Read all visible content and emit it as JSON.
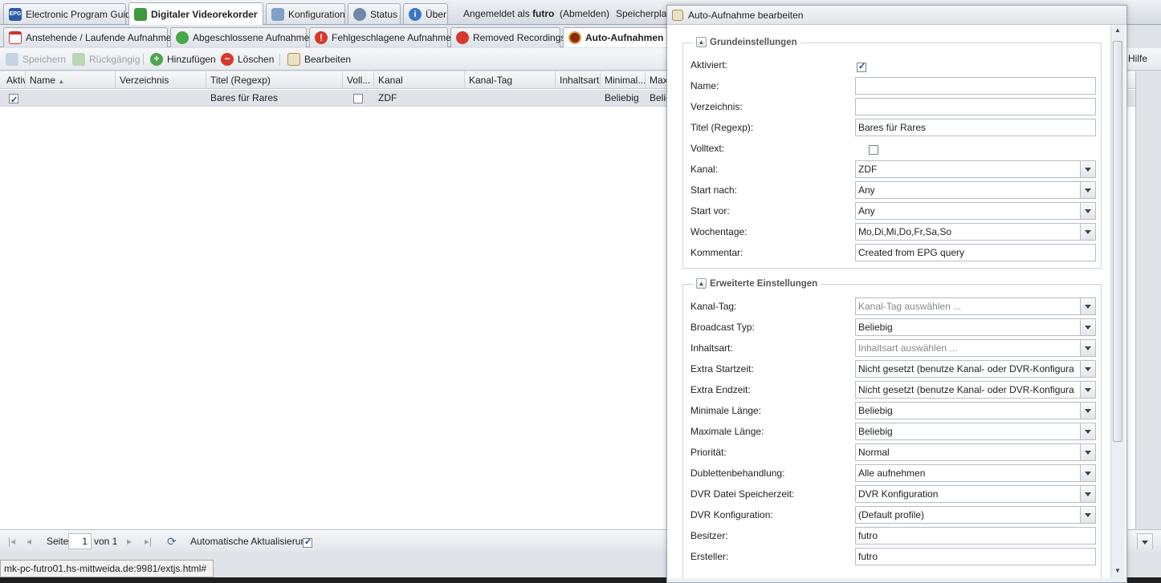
{
  "top_tabs": [
    {
      "label": "Electronic Program Guide",
      "icon": "epg-icon"
    },
    {
      "label": "Digitaler Videorekorder",
      "icon": "download-icon"
    },
    {
      "label": "Konfiguration",
      "icon": "wrench-icon"
    },
    {
      "label": "Status",
      "icon": "eye-icon"
    },
    {
      "label": "Über",
      "icon": "info-icon"
    }
  ],
  "top_info": {
    "logged_in_prefix": "Angemeldet als",
    "user": "futro",
    "logout": "(Abmelden)",
    "storage": "Speicherplatz",
    "help": "Hilfe"
  },
  "sub_tabs": [
    {
      "label": "Anstehende / Laufende Aufnahmen",
      "icon": "calendar-icon"
    },
    {
      "label": "Abgeschlossene Aufnahmen",
      "icon": "check-circle-icon"
    },
    {
      "label": "Fehlgeschlagene Aufnahmen",
      "icon": "error-icon"
    },
    {
      "label": "Removed Recordings",
      "icon": "remove-icon"
    },
    {
      "label": "Auto-Aufnahmen",
      "icon": "record-icon"
    }
  ],
  "toolbar": {
    "save": "Speichern",
    "undo": "Rückgängig",
    "add": "Hinzufügen",
    "delete": "Löschen",
    "edit": "Bearbeiten"
  },
  "grid": {
    "columns": [
      "Aktiv",
      "Name",
      "Verzeichnis",
      "Titel (Regexp)",
      "Voll...",
      "Kanal",
      "Kanal-Tag",
      "Inhaltsart",
      "Minimal...",
      "Max"
    ],
    "row": {
      "enabled": true,
      "name": "",
      "directory": "",
      "title": "Bares für Rares",
      "fulltext": false,
      "channel": "ZDF",
      "channel_tag": "",
      "content_type": "",
      "min": "Beliebig",
      "max": "Belie"
    }
  },
  "paging": {
    "page_label": "Seite",
    "page": "1",
    "of": "von 1",
    "auto_refresh": "Automatische Aktualisierung",
    "auto_refresh_checked": true
  },
  "status_url": "mk-pc-futro01.hs-mittweida.de:9981/extjs.html#",
  "dialog": {
    "title": "Auto-Aufnahme bearbeiten",
    "basic_legend": "Grundeinstellungen",
    "basic": {
      "enabled_label": "Aktiviert:",
      "enabled": true,
      "name_label": "Name:",
      "name": "",
      "directory_label": "Verzeichnis:",
      "directory": "",
      "title_label": "Titel (Regexp):",
      "title": "Bares für Rares",
      "fulltext_label": "Volltext:",
      "fulltext": false,
      "channel_label": "Kanal:",
      "channel": "ZDF",
      "start_after_label": "Start nach:",
      "start_after": "Any",
      "start_before_label": "Start vor:",
      "start_before": "Any",
      "weekdays_label": "Wochentage:",
      "weekdays": "Mo,Di,Mi,Do,Fr,Sa,So",
      "comment_label": "Kommentar:",
      "comment": "Created from EPG query"
    },
    "advanced_legend": "Erweiterte Einstellungen",
    "advanced": {
      "channel_tag_label": "Kanal-Tag:",
      "channel_tag_placeholder": "Kanal-Tag auswählen ...",
      "broadcast_type_label": "Broadcast Typ:",
      "broadcast_type": "Beliebig",
      "content_type_label": "Inhaltsart:",
      "content_type_placeholder": "Inhaltsart auswählen ...",
      "extra_start_label": "Extra Startzeit:",
      "extra_start": "Nicht gesetzt (benutze Kanal- oder DVR-Konfigura",
      "extra_end_label": "Extra Endzeit:",
      "extra_end": "Nicht gesetzt (benutze Kanal- oder DVR-Konfigura",
      "min_length_label": "Minimale Länge:",
      "min_length": "Beliebig",
      "max_length_label": "Maximale Länge:",
      "max_length": "Beliebig",
      "priority_label": "Priorität:",
      "priority": "Normal",
      "dup_label": "Dublettenbehandlung:",
      "dup": "Alle aufnehmen",
      "retention_label": "DVR Datei Speicherzeit:",
      "retention": "DVR Konfiguration",
      "dvr_config_label": "DVR Konfiguration:",
      "dvr_config": "(Default profile)",
      "owner_label": "Besitzer:",
      "owner": "futro",
      "creator_label": "Ersteller:",
      "creator": "futro"
    }
  }
}
